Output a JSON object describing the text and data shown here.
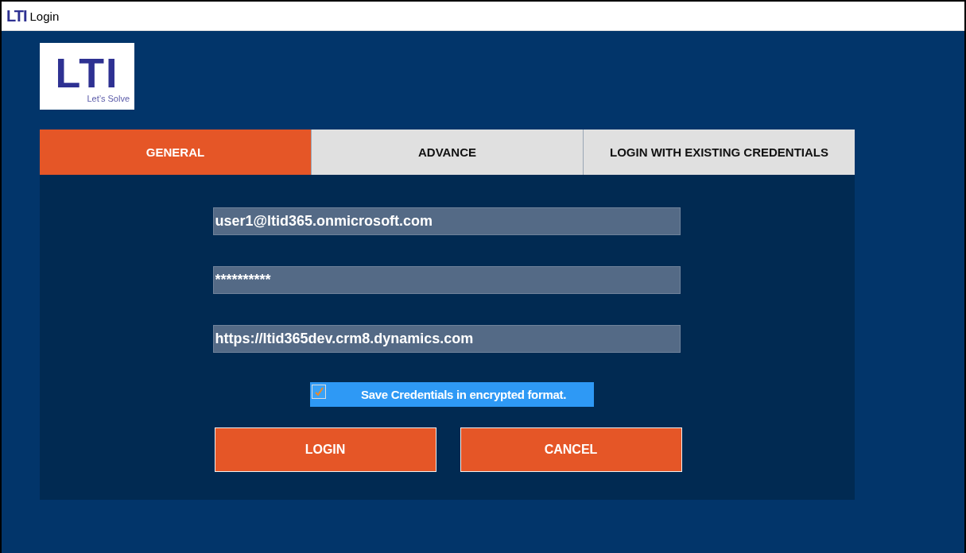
{
  "window": {
    "title": "Login",
    "icon_text": "LTI"
  },
  "logo": {
    "mark": "LTI",
    "tagline": "Let’s Solve"
  },
  "tabs": [
    {
      "label": "GENERAL",
      "selected": true
    },
    {
      "label": "ADVANCE",
      "selected": false
    },
    {
      "label": "LOGIN WITH EXISTING CREDENTIALS",
      "selected": false
    }
  ],
  "fields": [
    {
      "value": "user1@ltid365.onmicrosoft.com"
    },
    {
      "value": "**********"
    },
    {
      "value": "https://ltid365dev.crm8.dynamics.com"
    }
  ],
  "save_credentials": {
    "label": "Save Credentials in encrypted format.",
    "checked": true
  },
  "buttons": [
    "LOGIN",
    "CANCEL"
  ]
}
